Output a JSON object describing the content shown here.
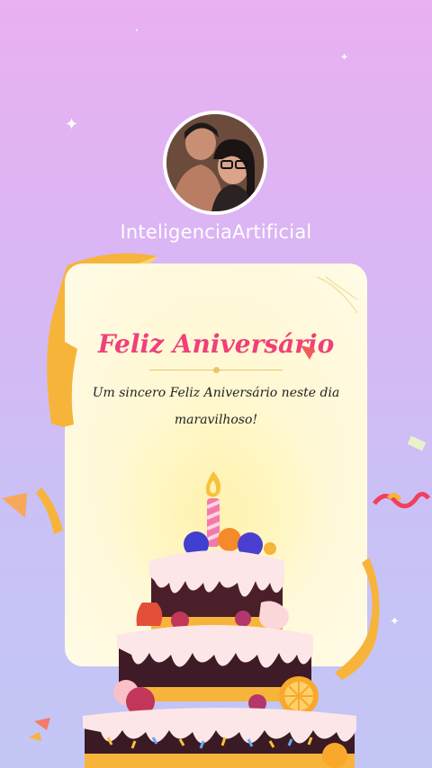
{
  "profile": {
    "username": "InteligenciaArtificial"
  },
  "card": {
    "title": "Feliz Aniversário",
    "message": "Um sincero Feliz Aniversário neste dia maravilhoso!"
  },
  "colors": {
    "background_top": "#e9b0f2",
    "background_bottom": "#c3c6f5",
    "title": "#f0407a",
    "card": "#fff9d9",
    "ribbon": "#f7b43a"
  },
  "icons": [
    "sparkle-icon",
    "avatar",
    "ribbon",
    "birthday-cake",
    "candle"
  ]
}
